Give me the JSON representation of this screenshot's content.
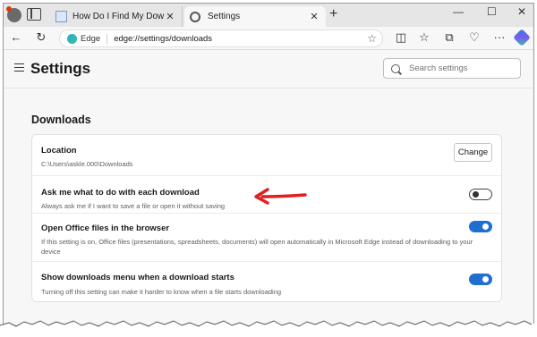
{
  "browser": {
    "tabs": [
      {
        "title": "How Do I Find My Downloads on",
        "close": "✕"
      },
      {
        "title": "Settings",
        "close": "✕"
      }
    ],
    "new_tab": "+",
    "window_controls": {
      "minimize": "—",
      "maximize": "☐",
      "close": "✕"
    },
    "toolbar": {
      "back": "←",
      "refresh": "↻",
      "site_label": "Edge",
      "url_prefix": "edge://",
      "url_rest": "settings/downloads",
      "more": "···"
    }
  },
  "header": {
    "title": "Settings",
    "search_placeholder": "Search settings"
  },
  "downloads": {
    "section_title": "Downloads",
    "location": {
      "label": "Location",
      "path": "C:\\Users\\askle.000\\Downloads",
      "button": "Change"
    },
    "settings": [
      {
        "label": "Ask me what to do with each download",
        "desc": "Always ask me if I want to save a file or open it without saving",
        "enabled": false
      },
      {
        "label": "Open Office files in the browser",
        "desc": "If this setting is on, Office files (presentations, spreadsheets, documents) will open automatically in Microsoft Edge instead of downloading to your device",
        "enabled": true
      },
      {
        "label": "Show downloads menu when a download starts",
        "desc": "Turning off this setting can make it harder to know when a file starts downloading",
        "enabled": true
      }
    ]
  },
  "colors": {
    "accent": "#1f6fd0",
    "annotation": "#e02020"
  }
}
